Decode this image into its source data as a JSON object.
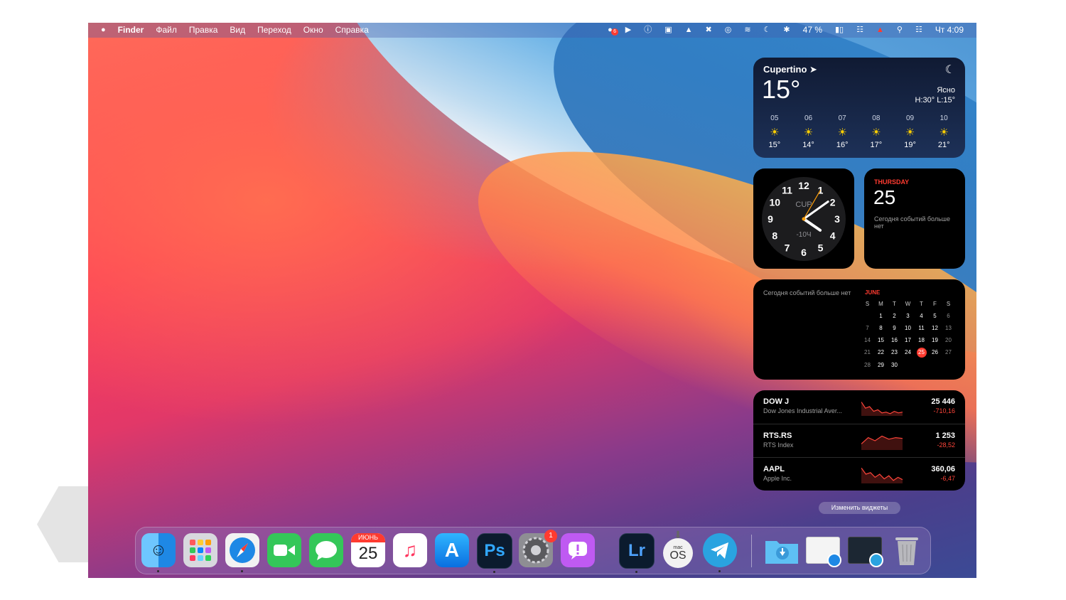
{
  "menubar": {
    "apple": "",
    "app": "Finder",
    "menus": [
      "Файл",
      "Правка",
      "Вид",
      "Переход",
      "Окно",
      "Справка"
    ],
    "status": {
      "notif_badge": "6",
      "battery": "47 %",
      "clock": "Чт 4:09"
    }
  },
  "weather": {
    "city": "Cupertino ➤",
    "temp": "15°",
    "condition": "Ясно",
    "hilo": "H:30° L:15°",
    "hours": [
      {
        "time": "05",
        "icon": "sunrise-icon",
        "temp": "15°"
      },
      {
        "time": "06",
        "icon": "sun-icon",
        "temp": "14°"
      },
      {
        "time": "07",
        "icon": "sun-icon",
        "temp": "16°"
      },
      {
        "time": "08",
        "icon": "sun-icon",
        "temp": "17°"
      },
      {
        "time": "09",
        "icon": "sun-icon",
        "temp": "19°"
      },
      {
        "time": "10",
        "icon": "sun-icon",
        "temp": "21°"
      }
    ]
  },
  "clock": {
    "city": "CUP",
    "offset": "-10Ч",
    "hour": 4,
    "minute": 9,
    "second": 5,
    "numbers": [
      "12",
      "1",
      "2",
      "3",
      "4",
      "5",
      "6",
      "7",
      "8",
      "9",
      "10",
      "11"
    ]
  },
  "date_widget": {
    "weekday": "THURSDAY",
    "day": "25",
    "message": "Сегодня событий больше нет"
  },
  "calendar_widget": {
    "message": "Сегодня событий больше нет",
    "month": "JUNE",
    "weekdays": [
      "S",
      "M",
      "T",
      "W",
      "T",
      "F",
      "S"
    ],
    "weeks": [
      [
        "",
        "1",
        "2",
        "3",
        "4",
        "5",
        "6"
      ],
      [
        "7",
        "8",
        "9",
        "10",
        "11",
        "12",
        "13"
      ],
      [
        "14",
        "15",
        "16",
        "17",
        "18",
        "19",
        "20"
      ],
      [
        "21",
        "22",
        "23",
        "24",
        "25",
        "26",
        "27"
      ],
      [
        "28",
        "29",
        "30",
        "",
        "",
        "",
        ""
      ]
    ],
    "today": "25"
  },
  "stocks": [
    {
      "symbol": "DOW J",
      "name": "Dow Jones Industrial Aver...",
      "value": "25 446",
      "change": "-710,16",
      "trend": [
        0.2,
        0.6,
        0.5,
        0.8,
        0.7,
        0.9,
        0.85,
        0.95,
        0.8,
        0.9,
        0.85
      ]
    },
    {
      "symbol": "RTS.RS",
      "name": "RTS Index",
      "value": "1 253",
      "change": "-28,52",
      "trend": [
        0.7,
        0.3,
        0.5,
        0.2,
        0.4,
        0.3,
        0.35
      ]
    },
    {
      "symbol": "AAPL",
      "name": "Apple Inc.",
      "value": "360,06",
      "change": "-6,47",
      "trend": [
        0.1,
        0.5,
        0.4,
        0.7,
        0.5,
        0.8,
        0.6,
        0.9,
        0.7,
        0.85
      ]
    }
  ],
  "edit_widgets": "Изменить виджеты",
  "colors": {
    "accent_red": "#ff3b30",
    "weather_sun": "#ffd000"
  },
  "dock": {
    "calendar_month": "ИЮНЬ",
    "calendar_day": "25",
    "ps": "Ps",
    "lr": "Lr",
    "macos_small": "mac",
    "macos_big": "OS",
    "prefs_badge": "1"
  }
}
